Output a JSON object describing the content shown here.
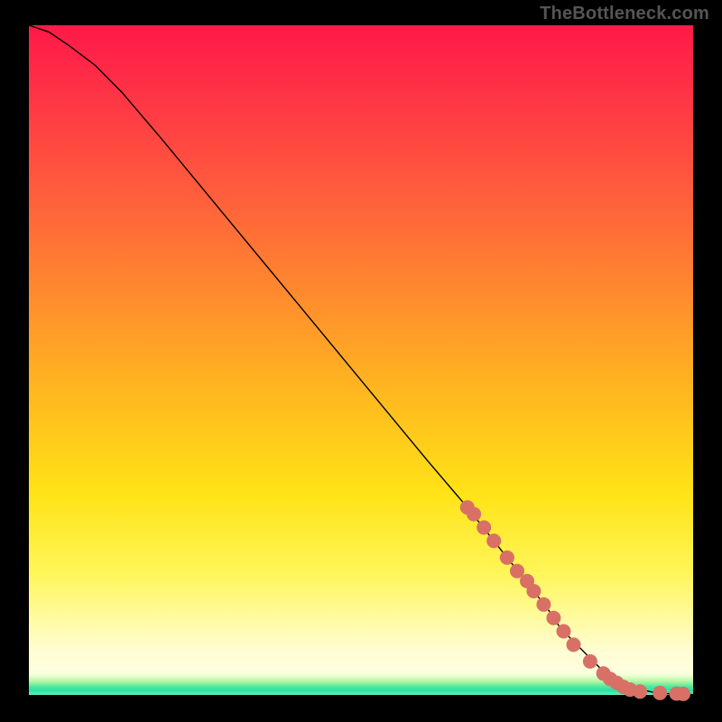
{
  "watermark": "TheBottleneck.com",
  "chart_data": {
    "type": "line",
    "title": "",
    "xlabel": "",
    "ylabel": "",
    "xlim": [
      0,
      100
    ],
    "ylim": [
      0,
      100
    ],
    "grid": false,
    "legend": false,
    "series": [
      {
        "name": "bottleneck-curve",
        "type": "line",
        "x": [
          0,
          3,
          6,
          10,
          14,
          20,
          30,
          40,
          50,
          60,
          66,
          70,
          74,
          78,
          80,
          82,
          84,
          86,
          88,
          90,
          92,
          94,
          96,
          98,
          100
        ],
        "y": [
          100,
          99,
          97,
          94,
          90,
          83,
          71,
          59,
          47,
          35,
          28,
          23,
          18,
          13,
          10,
          8,
          6,
          4,
          2.5,
          1.5,
          0.8,
          0.4,
          0.2,
          0.1,
          0.05
        ]
      },
      {
        "name": "highlighted-points",
        "type": "scatter",
        "x": [
          66,
          67,
          68.5,
          70,
          72,
          73.5,
          75,
          76,
          77.5,
          79,
          80.5,
          82,
          84.5,
          86.5,
          87.5,
          88.5,
          89.5,
          90.5,
          92,
          95,
          97.5,
          98.5
        ],
        "y": [
          28,
          27,
          25,
          23,
          20.5,
          18.5,
          17,
          15.5,
          13.5,
          11.5,
          9.5,
          7.5,
          5,
          3.2,
          2.4,
          1.8,
          1.2,
          0.8,
          0.5,
          0.3,
          0.2,
          0.15
        ]
      }
    ],
    "background_gradient": {
      "orientation": "vertical",
      "stops": [
        {
          "pos": 0.0,
          "color": "#ff1a47"
        },
        {
          "pos": 0.24,
          "color": "#ff5a3d"
        },
        {
          "pos": 0.55,
          "color": "#ffb81f"
        },
        {
          "pos": 0.82,
          "color": "#fff65a"
        },
        {
          "pos": 0.93,
          "color": "#fffdcf"
        },
        {
          "pos": 0.965,
          "color": "#4de89c"
        },
        {
          "pos": 1.0,
          "color": "#67eec2"
        }
      ]
    }
  },
  "colors": {
    "scatter": "#d87066",
    "curve": "#000000",
    "page_bg": "#000000",
    "watermark": "#555555"
  }
}
